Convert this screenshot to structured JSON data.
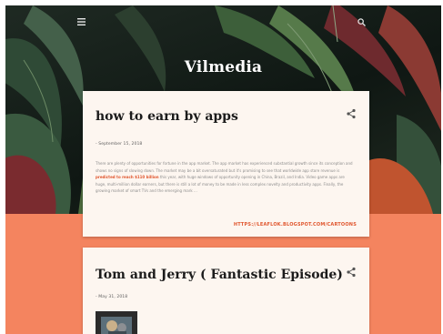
{
  "header": {
    "site_title": "Vilmedia",
    "menu_icon": "hamburger-menu-icon",
    "search_icon": "search-icon"
  },
  "colors": {
    "accent": "#f4845f",
    "link": "#e0562e",
    "card_bg": "#fdf6f0",
    "hero_bg": "#142019"
  },
  "posts": [
    {
      "title": "how to earn by apps",
      "date": "- September 15, 2018",
      "excerpt_before": "There are plenty of opportunities for fortune in the app market. The app market has experienced substantial growth since its conception and shows no signs of slowing down. The market may be a bit oversaturated but it's promising to see that worldwide app store revenue is ",
      "excerpt_highlight": "predicted to reach $110 billion",
      "excerpt_after": " this year, with huge windows of opportunity opening in China, Brazil, and India. Video game apps are huge, multi-million dollar earners, but there is still a lot of money to be made in less complex novelty and productivity apps. Finally, the growing market of smart TVs and the emerging mark …",
      "link": "HTTPS://LEAFLOK.BLOGSPOT.COM/CARTOONS",
      "share_icon": "share-icon"
    },
    {
      "title": "Tom and Jerry ( Fantastic Episode)",
      "date": "- May 31, 2018",
      "share_icon": "share-icon",
      "thumbnail": "cartoon-thumbnail-image"
    }
  ]
}
